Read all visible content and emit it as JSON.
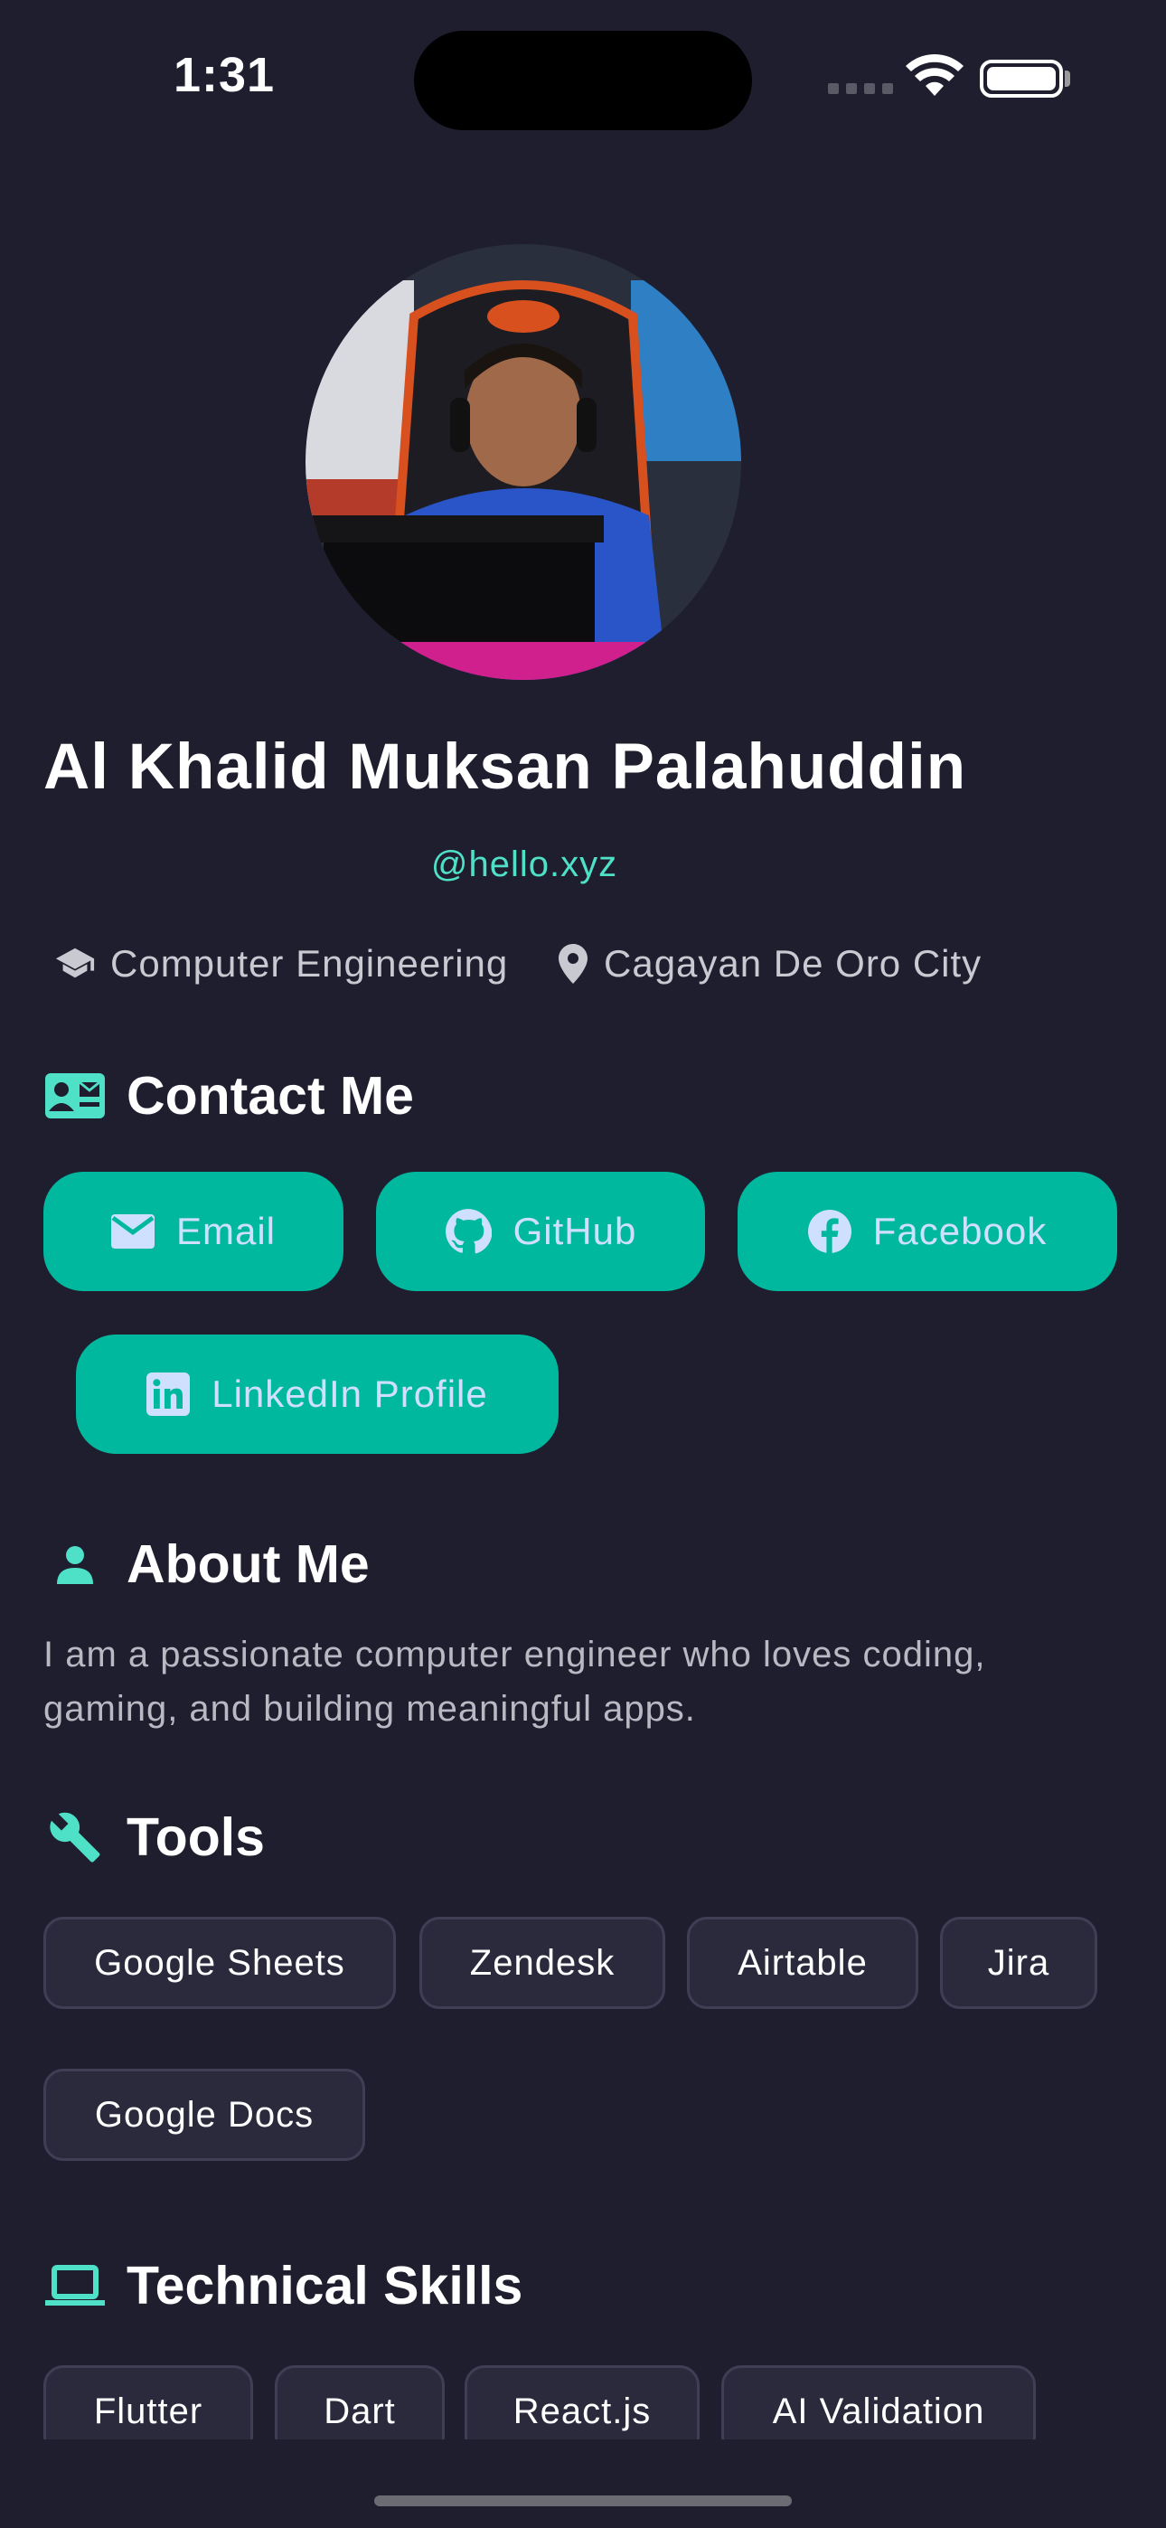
{
  "status_bar": {
    "time": "1:31"
  },
  "profile": {
    "name": "Al Khalid Muksan Palahuddin",
    "handle": "@hello.xyz",
    "field": "Computer Engineering",
    "location": "Cagayan De Oro City"
  },
  "contact": {
    "title": "Contact Me",
    "buttons": [
      {
        "label": "Email",
        "icon": "email-icon"
      },
      {
        "label": "GitHub",
        "icon": "github-icon"
      },
      {
        "label": "Facebook",
        "icon": "facebook-icon"
      },
      {
        "label": "LinkedIn Profile",
        "icon": "linkedin-icon"
      }
    ]
  },
  "about": {
    "title": "About Me",
    "text": "I am a passionate computer engineer who loves coding, gaming, and building meaningful apps."
  },
  "tools": {
    "title": "Tools",
    "items": [
      "Google Sheets",
      "Zendesk",
      "Airtable",
      "Jira",
      "Google Docs"
    ]
  },
  "skills": {
    "title": "Technical Skills",
    "items": [
      "Flutter",
      "Dart",
      "React.js",
      "AI Validation"
    ]
  },
  "colors": {
    "background": "#1f1e2e",
    "accent": "#00b89e",
    "handle": "#4fe0c8",
    "chip_bg": "#2b2a3d"
  }
}
